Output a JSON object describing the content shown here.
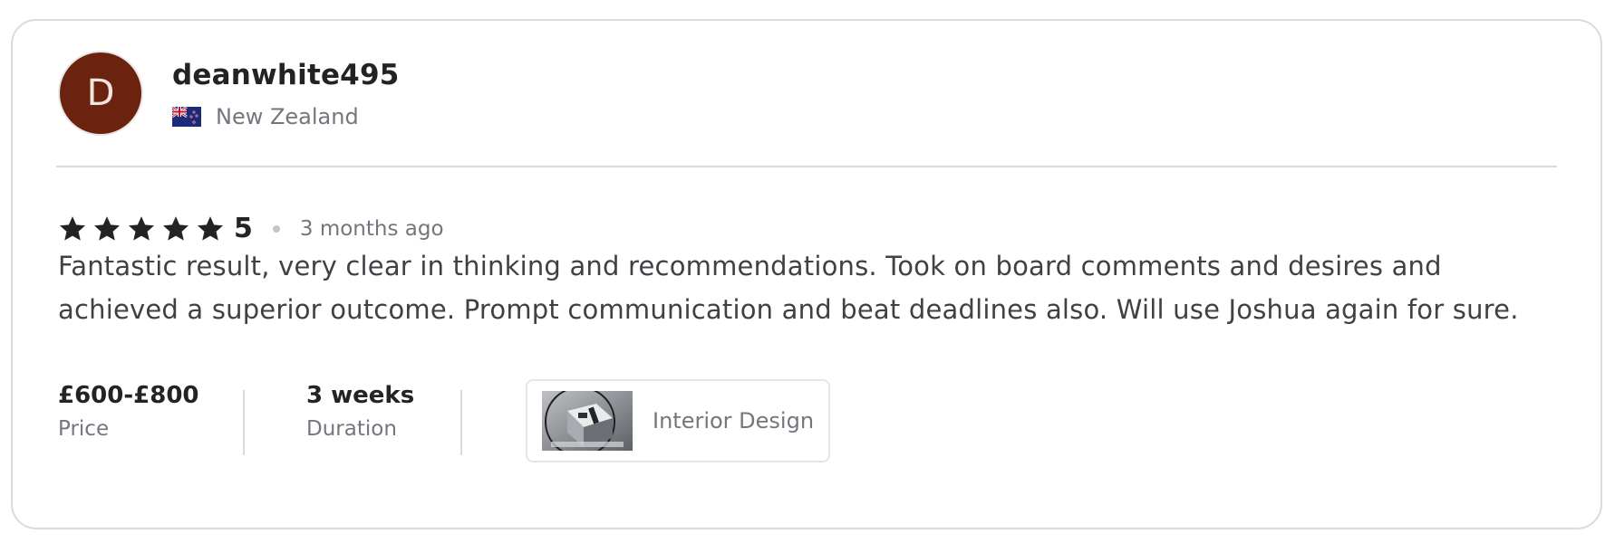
{
  "review": {
    "avatar_initial": "D",
    "username": "deanwhite495",
    "country": "New Zealand",
    "rating": "5",
    "rating_stars": 5,
    "time_ago": "3 months ago",
    "text": "Fantastic result, very clear in thinking and recommendations. Took on board comments and desires and achieved a superior outcome. Prompt communication and beat deadlines also. Will use Joshua again for sure.",
    "price": {
      "value": "£600-£800",
      "label": "Price"
    },
    "duration": {
      "value": "3 weeks",
      "label": "Duration"
    },
    "category": {
      "name": "Interior Design",
      "thumbnail_icon": "interior-design-thumbnail"
    }
  },
  "colors": {
    "avatar_bg": "#6b230f",
    "star": "#222325",
    "text": "#404145",
    "muted": "#74767e",
    "border": "#dadbdd"
  },
  "icons": {
    "flag": "new-zealand-flag-icon",
    "star": "star-icon"
  }
}
